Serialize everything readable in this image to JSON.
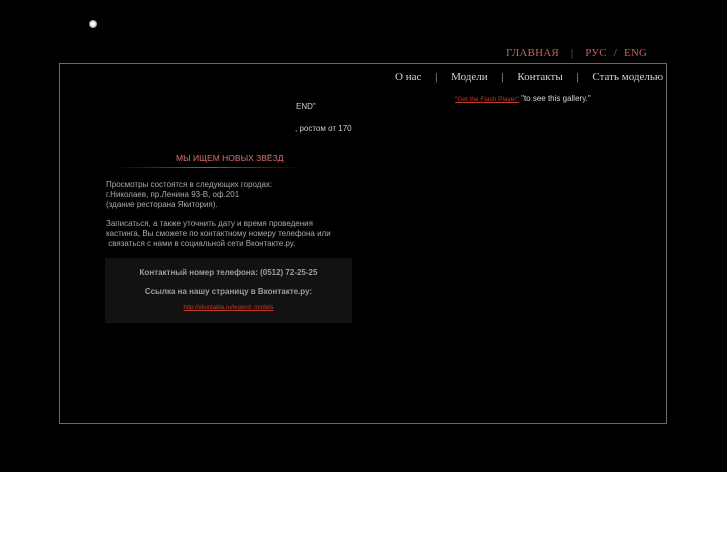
{
  "top_nav": {
    "home": "ГЛАВНАЯ",
    "separator": "|",
    "lang_ru": "РУС",
    "lang_slash": "/",
    "lang_en": "ENG"
  },
  "menu": {
    "items": [
      "О нас",
      "Модели",
      "Контакты",
      "Стать моделью"
    ],
    "separator": "|"
  },
  "flash_notice": {
    "link": "\"Get the Flash Player\"",
    "text": " \"to see this gallery.\""
  },
  "truncated_text": {
    "line1": "END\"",
    "line2": ", ростом от 170"
  },
  "heading": "МЫ ИЩЕМ НОВЫХ ЗВЁЗД",
  "paragraph1": "Просмотры состоятся в следующих городах:\nг.Николаев, пр.Ленина 93-В, оф.201\n(здание ресторана Якитория).",
  "paragraph2": "Записаться, а также уточнить дату и время проведения\nкастинга, Вы сможете по контактному номеру телефона или\n связаться с нами в социальной сети Вконтакте.ру.",
  "info_box": {
    "phone": "Контактный номер телефона: (0512) 72-25-25",
    "vk_label": "Ссылка на нашу страницу  в Вконтакте.ру:",
    "vk_link": "http://vkontakte.ru/legend_models"
  },
  "colors": {
    "background": "#000000",
    "accent": "#c4615a",
    "link": "#c0392b"
  }
}
